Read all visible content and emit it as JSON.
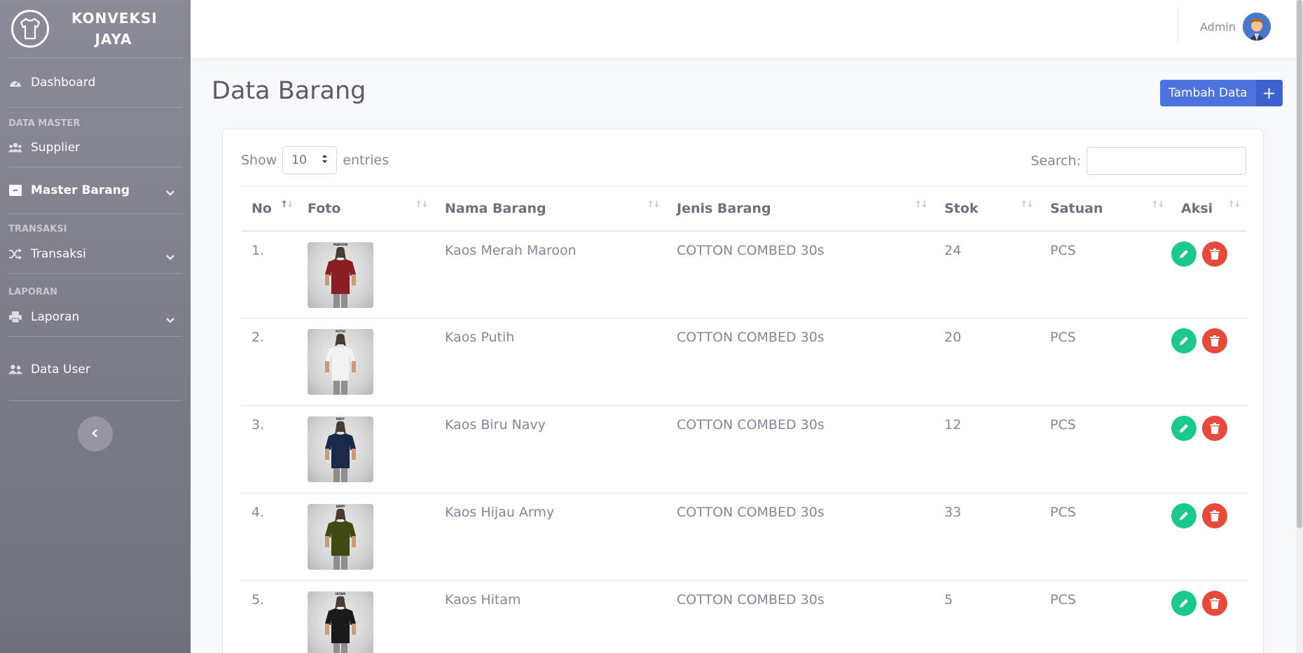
{
  "brand": {
    "line1": "KONVEKSI",
    "line2": "JAYA"
  },
  "sidebar": {
    "dashboard": "Dashboard",
    "section_master": "DATA MASTER",
    "supplier": "Supplier",
    "master_barang": "Master Barang",
    "section_transaksi": "TRANSAKSI",
    "transaksi": "Transaksi",
    "section_laporan": "LAPORAN",
    "laporan": "Laporan",
    "data_user": "Data User"
  },
  "topbar": {
    "user_name": "Admin"
  },
  "page": {
    "title": "Data Barang",
    "add_label": "Tambah Data",
    "add_icon": "+"
  },
  "table_controls": {
    "show_label": "Show",
    "length_value": "10",
    "entries_label": "entries",
    "search_label": "Search:"
  },
  "table": {
    "headers": [
      "No",
      "Foto",
      "Nama Barang",
      "Jenis Barang",
      "Stok",
      "Satuan",
      "Aksi"
    ],
    "rows": [
      {
        "no": "1.",
        "nama": "Kaos Merah Maroon",
        "jenis": "COTTON COMBED 30s",
        "stok": "24",
        "satuan": "PCS",
        "shirt_color": "#8b1e23",
        "tag": "MAROON"
      },
      {
        "no": "2.",
        "nama": "Kaos Putih",
        "jenis": "COTTON COMBED 30s",
        "stok": "20",
        "satuan": "PCS",
        "shirt_color": "#f2f2f2",
        "tag": "PUTIH"
      },
      {
        "no": "3.",
        "nama": "Kaos Biru Navy",
        "jenis": "COTTON COMBED 30s",
        "stok": "12",
        "satuan": "PCS",
        "shirt_color": "#1b2848",
        "tag": "NAVY"
      },
      {
        "no": "4.",
        "nama": "Kaos Hijau Army",
        "jenis": "COTTON COMBED 30s",
        "stok": "33",
        "satuan": "PCS",
        "shirt_color": "#3f4a12",
        "tag": "ARMY"
      },
      {
        "no": "5.",
        "nama": "Kaos Hitam",
        "jenis": "COTTON COMBED 30s",
        "stok": "5",
        "satuan": "PCS",
        "shirt_color": "#1a1a1a",
        "tag": "HITAM"
      }
    ]
  },
  "colors": {
    "primary": "#4e73df",
    "success": "#1cc88a",
    "danger": "#e74a3b"
  },
  "icons": [
    "tshirt-logo-icon",
    "dashboard-icon",
    "users-icon",
    "box-icon",
    "shuffle-icon",
    "print-icon",
    "user-group-icon",
    "chevron-down-icon",
    "chevron-left-icon",
    "pencil-icon",
    "trash-icon",
    "sort-icon"
  ]
}
